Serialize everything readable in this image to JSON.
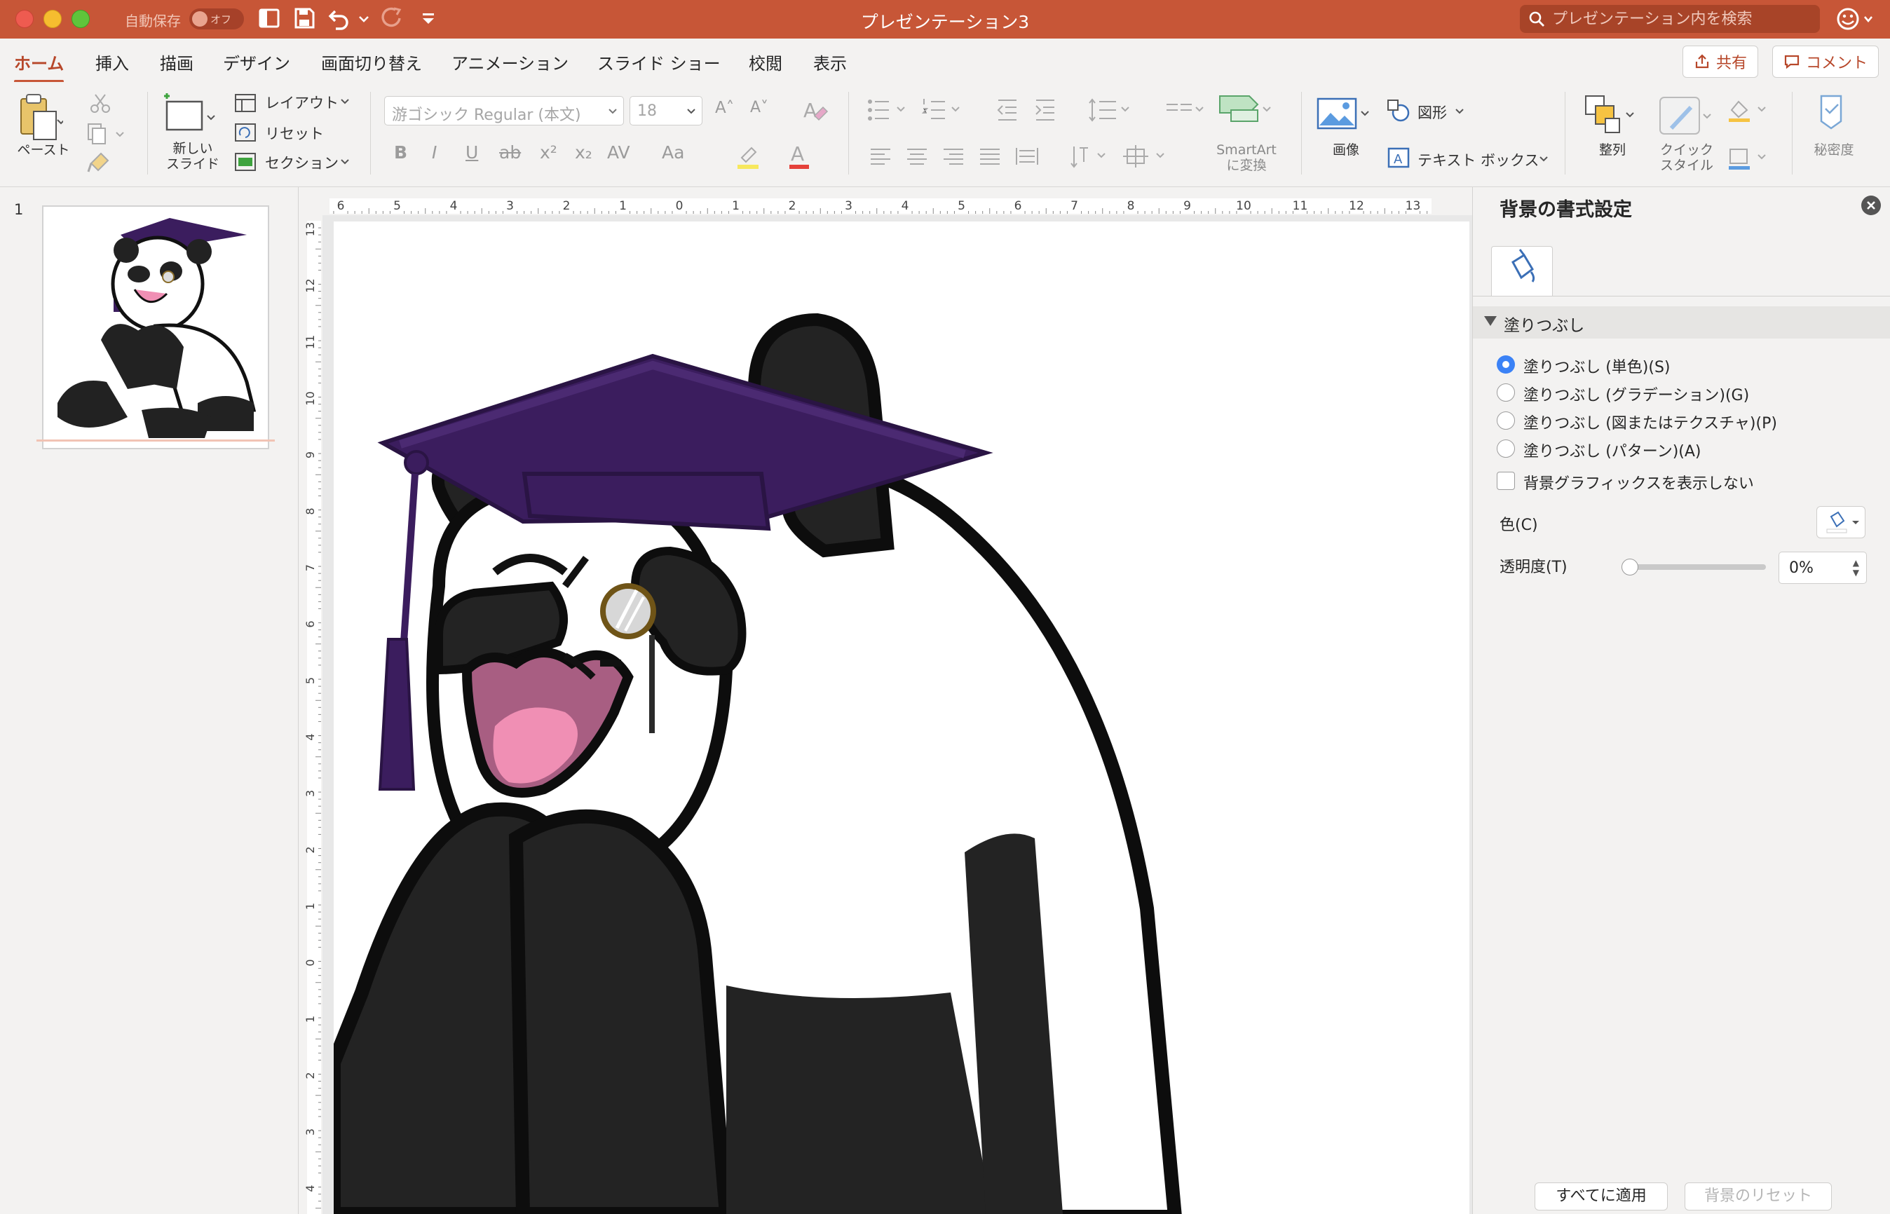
{
  "window": {
    "title": "プレゼンテーション3",
    "autosave_label": "自動保存",
    "autosave_state": "オフ",
    "search_placeholder": "プレゼンテーション内を検索"
  },
  "tabs": [
    {
      "label": "ホーム",
      "active": true
    },
    {
      "label": "挿入"
    },
    {
      "label": "描画"
    },
    {
      "label": "デザイン"
    },
    {
      "label": "画面切り替え"
    },
    {
      "label": "アニメーション"
    },
    {
      "label": "スライド ショー"
    },
    {
      "label": "校閲"
    },
    {
      "label": "表示"
    }
  ],
  "share": {
    "share_label": "共有",
    "comment_label": "コメント"
  },
  "ribbon": {
    "paste": "ペースト",
    "new_slide_1": "新しい",
    "new_slide_2": "スライド",
    "layout": "レイアウト",
    "reset": "リセット",
    "section": "セクション",
    "font_name": "游ゴシック Regular (本文)",
    "font_size": "18",
    "smartart_1": "SmartArt",
    "smartart_2": "に変換",
    "picture": "画像",
    "shapes": "図形",
    "textbox": "テキスト ボックス",
    "arrange": "整列",
    "quick_style_1": "クイック",
    "quick_style_2": "スタイル",
    "sensitivity": "秘密度"
  },
  "thumbnails": [
    {
      "number": "1"
    }
  ],
  "ruler": {
    "h_labels": [
      "6",
      "5",
      "4",
      "3",
      "2",
      "1",
      "0",
      "1",
      "2",
      "3",
      "4",
      "5",
      "6",
      "7",
      "8",
      "9",
      "10",
      "11",
      "12",
      "13"
    ],
    "v_labels": [
      "13",
      "12",
      "11",
      "10",
      "9",
      "8",
      "7",
      "6",
      "5",
      "4",
      "3",
      "2",
      "1",
      "0",
      "1",
      "2",
      "3",
      "4"
    ]
  },
  "format_pane": {
    "title": "背景の書式設定",
    "section": "塗りつぶし",
    "options": [
      {
        "label": "塗りつぶし (単色)(S)",
        "selected": true
      },
      {
        "label": "塗りつぶし (グラデーション)(G)",
        "selected": false
      },
      {
        "label": "塗りつぶし (図またはテクスチャ)(P)",
        "selected": false
      },
      {
        "label": "塗りつぶし (パターン)(A)",
        "selected": false
      }
    ],
    "hide_graphics": "背景グラフィックスを表示しない",
    "color_label": "色(C)",
    "transparency_label": "透明度(T)",
    "transparency_value": "0%",
    "transparency_level": 0,
    "apply_all": "すべてに適用",
    "reset_bg": "背景のリセット"
  },
  "colors": {
    "accent": "#c75637",
    "cap": "#3b1d5e"
  }
}
